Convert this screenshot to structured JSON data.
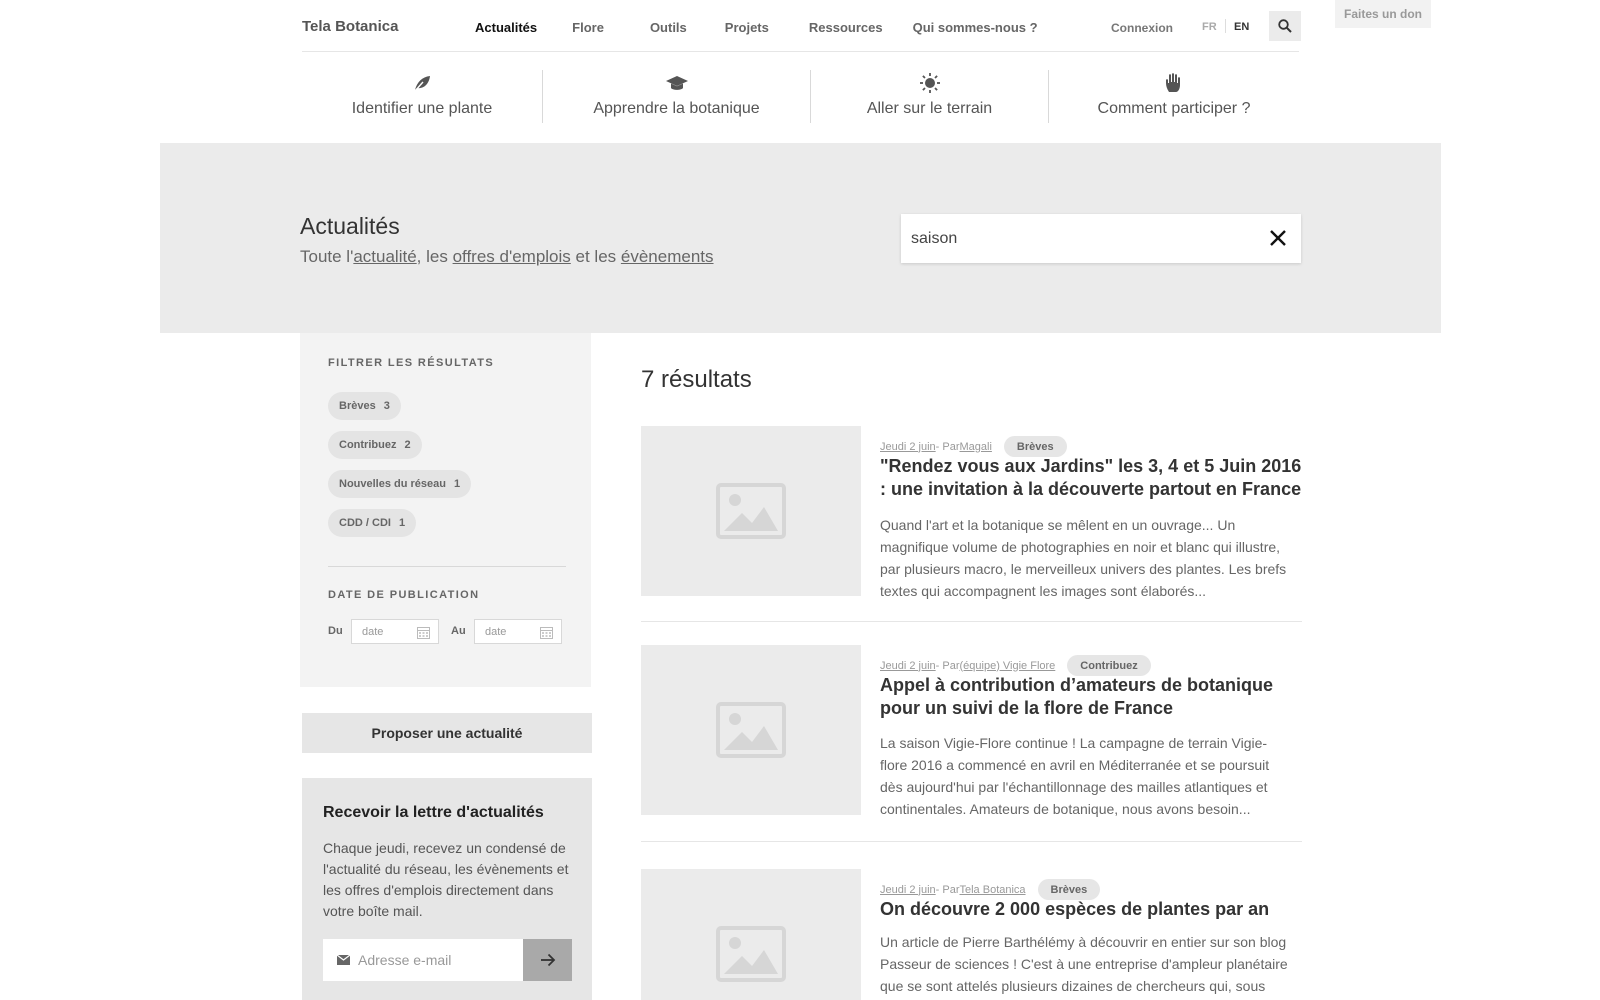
{
  "header": {
    "brand": "Tela Botanica",
    "menu": [
      "Actualités",
      "Flore",
      "Outils",
      "Projets",
      "Ressources",
      "Qui sommes-nous ?"
    ],
    "connexion": "Connexion",
    "lang_fr": "FR",
    "lang_en": "EN",
    "donate": "Faites un don"
  },
  "subnav": [
    {
      "label": "Identifier une plante",
      "icon": "leaf-icon"
    },
    {
      "label": "Apprendre la botanique",
      "icon": "graduation-cap-icon"
    },
    {
      "label": "Aller sur le terrain",
      "icon": "sun-icon"
    },
    {
      "label": "Comment participer ?",
      "icon": "hand-icon"
    }
  ],
  "hero": {
    "title": "Actualités",
    "sub_prefix": "Toute l'",
    "sub_link1": "actualité",
    "sub_mid1": ", les ",
    "sub_link2": "offres d'emplois",
    "sub_mid2": " et les ",
    "sub_link3": "évènements",
    "search_value": "saison"
  },
  "filters": {
    "title": "FILTRER LES RÉSULTATS",
    "chips": [
      {
        "label": "Brèves",
        "count": "3"
      },
      {
        "label": "Contribuez",
        "count": "2"
      },
      {
        "label": "Nouvelles du réseau",
        "count": "1"
      },
      {
        "label": "CDD / CDI",
        "count": "1"
      }
    ],
    "date_title": "DATE DE PUBLICATION",
    "from_label": "Du",
    "to_label": "Au",
    "date_placeholder": "date"
  },
  "propose_label": "Proposer une actualité",
  "newsletter": {
    "title": "Recevoir la lettre d'actualités",
    "text": "Chaque jeudi, recevez un condensé de l'actualité du réseau, les évènements et les offres d'emplois directement dans votre boîte mail.",
    "placeholder": "Adresse e-mail"
  },
  "results": {
    "count": "7 résultats",
    "articles": [
      {
        "date": "Jeudi 2 juin",
        "by": " - Par ",
        "author": "Magali",
        "category": "Brèves",
        "title": "\"Rendez vous aux Jardins\" les 3, 4 et 5 Juin 2016 : une invitation à la découverte partout en France",
        "excerpt": "Quand l'art et la botanique se mêlent en un ouvrage... Un magnifique volume de photographies en noir et blanc qui illustre, par plusieurs macro, le merveilleux univers des plantes. Les brefs textes qui accompagnent les images sont élaborés..."
      },
      {
        "date": "Jeudi 2 juin",
        "by": " - Par ",
        "author": "(équipe) Vigie Flore",
        "category": "Contribuez",
        "title": "Appel à contribution d’amateurs de botanique pour un suivi de la flore de France",
        "excerpt": "La saison Vigie-Flore continue ! La campagne de terrain Vigie-flore 2016 a commencé en avril en Méditerranée et se poursuit dès aujourd'hui par l'échantillonnage des mailles atlantiques et continentales. Amateurs de botanique, nous avons besoin..."
      },
      {
        "date": "Jeudi 2 juin",
        "by": " - Par ",
        "author": "Tela Botanica",
        "category": "Brèves",
        "title": "On découvre 2 000 espèces de plantes par an",
        "excerpt": "Un article de Pierre Barthélémy à découvrir en entier sur son blog Passeur de sciences ! C'est à une entreprise d'ampleur planétaire que se sont attelés plusieurs dizaines de chercheurs qui, sous"
      }
    ]
  }
}
